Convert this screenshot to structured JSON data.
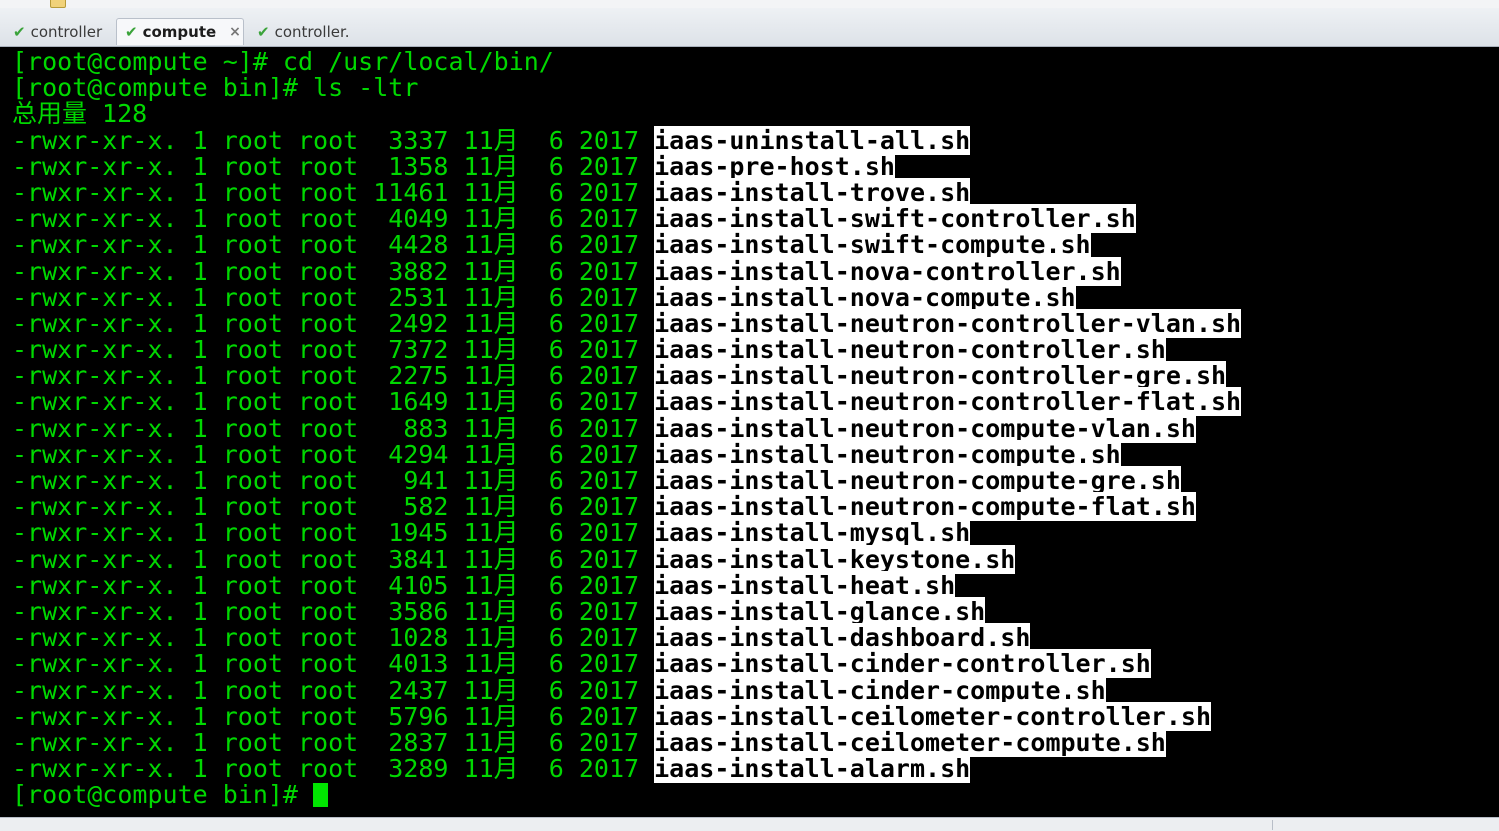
{
  "tabs": [
    {
      "label": "controller",
      "icon": "check-icon",
      "active": false
    },
    {
      "label": "compute",
      "icon": "check-icon",
      "active": true,
      "close": "×"
    },
    {
      "label": "controller.",
      "icon": "check-icon",
      "active": false
    }
  ],
  "colors": {
    "terminal_bg": "#000000",
    "terminal_fg": "#00d800",
    "highlight_bg": "#ffffff",
    "highlight_fg": "#000000"
  },
  "terminal": {
    "commands": [
      "[root@compute ~]# cd /usr/local/bin/",
      "[root@compute bin]# ls -ltr"
    ],
    "total": "总用量 128",
    "listing": [
      {
        "meta": "-rwxr-xr-x. 1 root root  3337 11月  6 2017 ",
        "name": "iaas-uninstall-all.sh"
      },
      {
        "meta": "-rwxr-xr-x. 1 root root  1358 11月  6 2017 ",
        "name": "iaas-pre-host.sh"
      },
      {
        "meta": "-rwxr-xr-x. 1 root root 11461 11月  6 2017 ",
        "name": "iaas-install-trove.sh"
      },
      {
        "meta": "-rwxr-xr-x. 1 root root  4049 11月  6 2017 ",
        "name": "iaas-install-swift-controller.sh"
      },
      {
        "meta": "-rwxr-xr-x. 1 root root  4428 11月  6 2017 ",
        "name": "iaas-install-swift-compute.sh"
      },
      {
        "meta": "-rwxr-xr-x. 1 root root  3882 11月  6 2017 ",
        "name": "iaas-install-nova-controller.sh"
      },
      {
        "meta": "-rwxr-xr-x. 1 root root  2531 11月  6 2017 ",
        "name": "iaas-install-nova-compute.sh"
      },
      {
        "meta": "-rwxr-xr-x. 1 root root  2492 11月  6 2017 ",
        "name": "iaas-install-neutron-controller-vlan.sh"
      },
      {
        "meta": "-rwxr-xr-x. 1 root root  7372 11月  6 2017 ",
        "name": "iaas-install-neutron-controller.sh"
      },
      {
        "meta": "-rwxr-xr-x. 1 root root  2275 11月  6 2017 ",
        "name": "iaas-install-neutron-controller-gre.sh"
      },
      {
        "meta": "-rwxr-xr-x. 1 root root  1649 11月  6 2017 ",
        "name": "iaas-install-neutron-controller-flat.sh"
      },
      {
        "meta": "-rwxr-xr-x. 1 root root   883 11月  6 2017 ",
        "name": "iaas-install-neutron-compute-vlan.sh"
      },
      {
        "meta": "-rwxr-xr-x. 1 root root  4294 11月  6 2017 ",
        "name": "iaas-install-neutron-compute.sh"
      },
      {
        "meta": "-rwxr-xr-x. 1 root root   941 11月  6 2017 ",
        "name": "iaas-install-neutron-compute-gre.sh"
      },
      {
        "meta": "-rwxr-xr-x. 1 root root   582 11月  6 2017 ",
        "name": "iaas-install-neutron-compute-flat.sh"
      },
      {
        "meta": "-rwxr-xr-x. 1 root root  1945 11月  6 2017 ",
        "name": "iaas-install-mysql.sh"
      },
      {
        "meta": "-rwxr-xr-x. 1 root root  3841 11月  6 2017 ",
        "name": "iaas-install-keystone.sh"
      },
      {
        "meta": "-rwxr-xr-x. 1 root root  4105 11月  6 2017 ",
        "name": "iaas-install-heat.sh"
      },
      {
        "meta": "-rwxr-xr-x. 1 root root  3586 11月  6 2017 ",
        "name": "iaas-install-glance.sh"
      },
      {
        "meta": "-rwxr-xr-x. 1 root root  1028 11月  6 2017 ",
        "name": "iaas-install-dashboard.sh"
      },
      {
        "meta": "-rwxr-xr-x. 1 root root  4013 11月  6 2017 ",
        "name": "iaas-install-cinder-controller.sh"
      },
      {
        "meta": "-rwxr-xr-x. 1 root root  2437 11月  6 2017 ",
        "name": "iaas-install-cinder-compute.sh"
      },
      {
        "meta": "-rwxr-xr-x. 1 root root  5796 11月  6 2017 ",
        "name": "iaas-install-ceilometer-controller.sh"
      },
      {
        "meta": "-rwxr-xr-x. 1 root root  2837 11月  6 2017 ",
        "name": "iaas-install-ceilometer-compute.sh"
      },
      {
        "meta": "-rwxr-xr-x. 1 root root  3289 11月  6 2017 ",
        "name": "iaas-install-alarm.sh"
      }
    ],
    "prompt": "[root@compute bin]# "
  }
}
